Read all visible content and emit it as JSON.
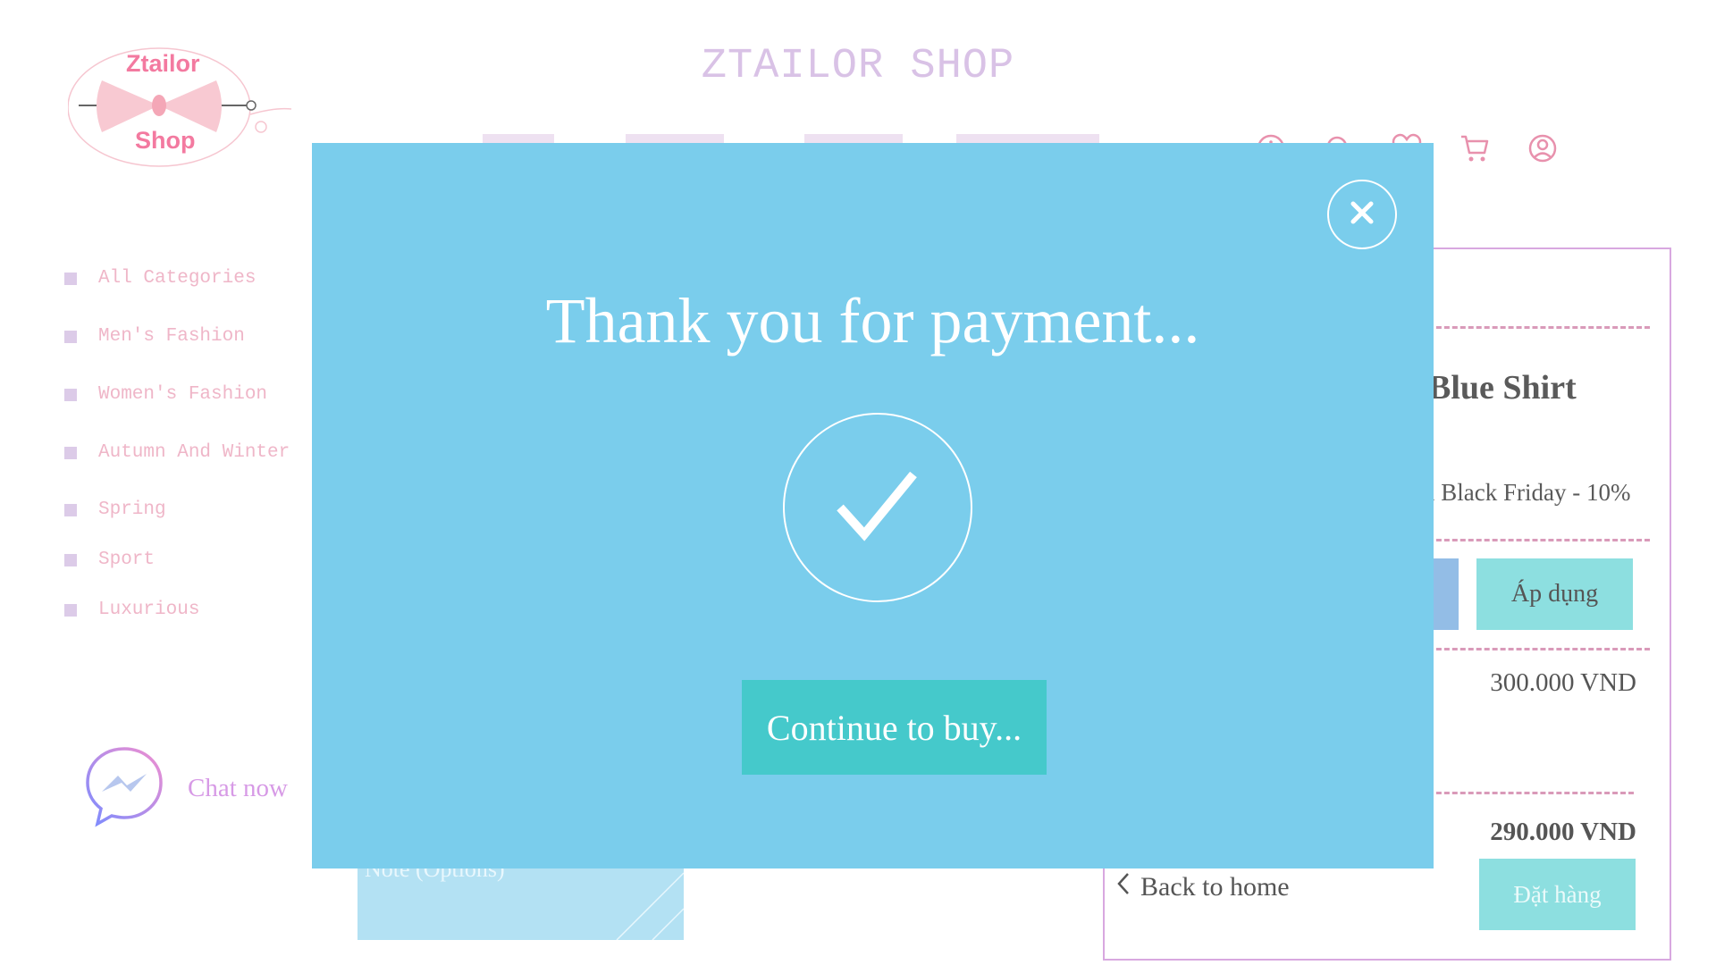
{
  "brand": {
    "logo_top_text": "Ztailor",
    "logo_bottom_text": "Shop",
    "shop_title": "ZTAILOR SHOP",
    "colors": {
      "pink": "#f37aa0",
      "bow": "#f8c9d2",
      "lavender": "#d9c2e6"
    }
  },
  "header_icons": [
    "info-icon",
    "search-icon",
    "heart-icon",
    "cart-icon",
    "account-icon"
  ],
  "sidebar": {
    "categories": [
      {
        "label": "All Categories"
      },
      {
        "label": "Men's Fashion"
      },
      {
        "label": "Women's Fashion"
      },
      {
        "label": "Autumn And Winter"
      },
      {
        "label": "Spring"
      },
      {
        "label": "Sport"
      },
      {
        "label": "Luxurious"
      }
    ]
  },
  "chat": {
    "label": "Chat now"
  },
  "note": {
    "placeholder": "Note (Options)"
  },
  "order": {
    "product_name": "Blue Shirt",
    "promo": "i Black Friday - 10%",
    "apply_label": "Áp dụng",
    "subtotal": "300.000 VND",
    "total": "290.000 VND",
    "back_label": "Back to home",
    "order_label": "Đặt hàng"
  },
  "modal": {
    "title": "Thank you for payment...",
    "continue_label": "Continue to buy...",
    "bg_color": "#7acdec",
    "button_color": "#45c9cb"
  }
}
